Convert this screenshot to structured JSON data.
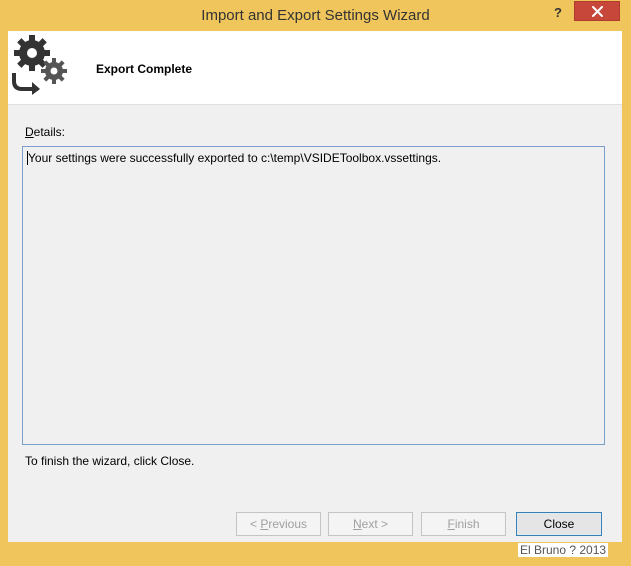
{
  "window": {
    "title": "Import and Export Settings Wizard",
    "help_label": "?",
    "accent_color": "#f0c65c"
  },
  "banner": {
    "title": "Export Complete",
    "icon": "gears-arrow-icon"
  },
  "details": {
    "label_mnemonic": "D",
    "label_rest": "etails:",
    "text": "Your settings were successfully exported to c:\\temp\\VSIDEToolbox.vssettings."
  },
  "hint": "To finish the wizard, click Close.",
  "buttons": {
    "previous_prefix": "< ",
    "previous_mnemonic": "P",
    "previous_rest": "revious",
    "next_mnemonic": "N",
    "next_rest": "ext >",
    "finish_mnemonic": "F",
    "finish_rest": "inish",
    "close_label": "Close"
  },
  "watermark": "El Bruno ? 2013"
}
